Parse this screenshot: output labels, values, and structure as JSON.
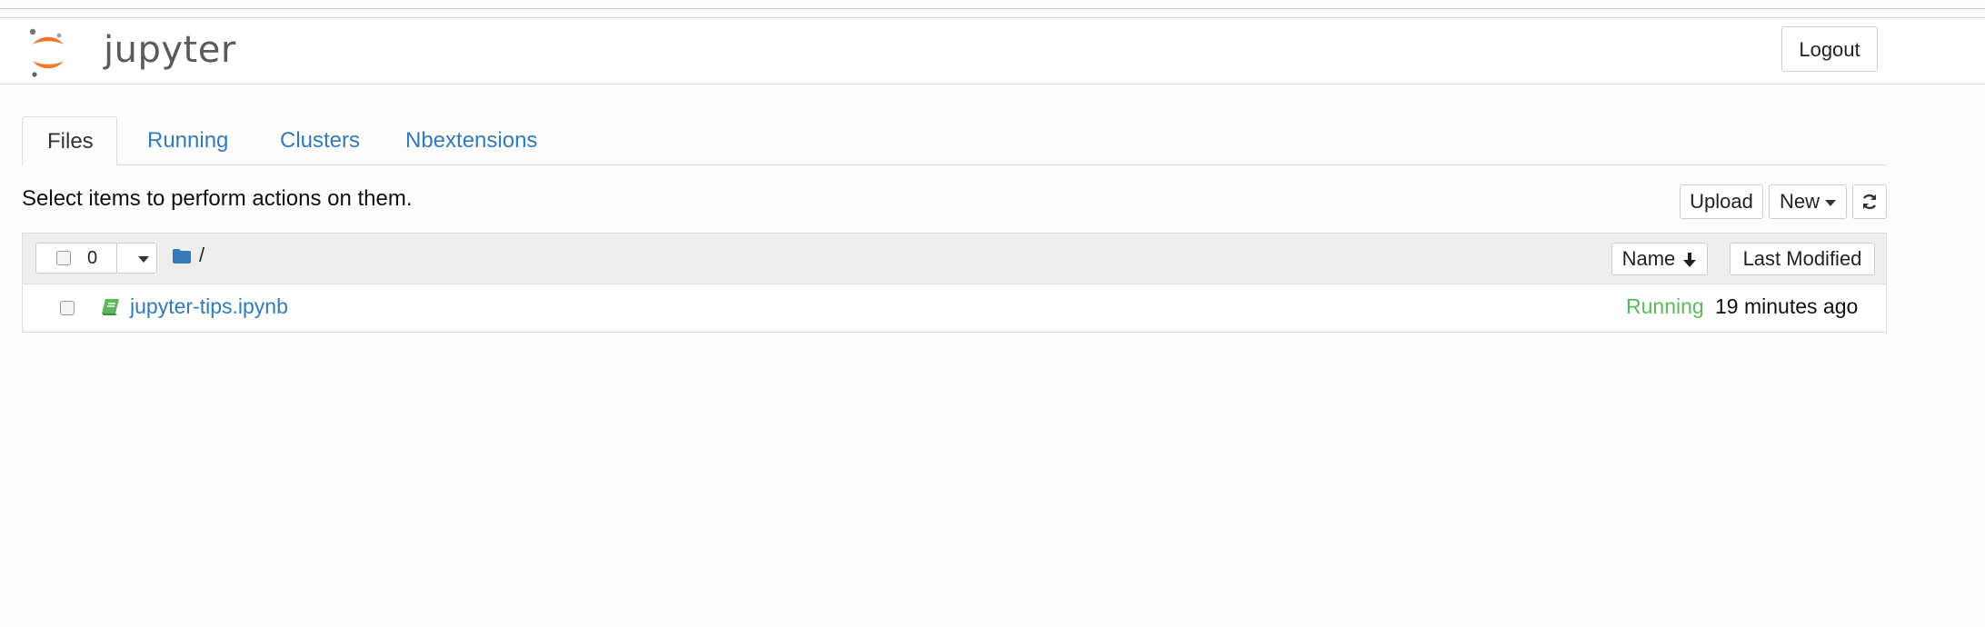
{
  "header": {
    "app_name": "jupyter",
    "logout_label": "Logout"
  },
  "tabs": [
    {
      "label": "Files",
      "active": true
    },
    {
      "label": "Running",
      "active": false
    },
    {
      "label": "Clusters",
      "active": false
    },
    {
      "label": "Nbextensions",
      "active": false
    }
  ],
  "toolbar": {
    "hint_text": "Select items to perform actions on them.",
    "upload_label": "Upload",
    "new_label": "New",
    "refresh_icon": "refresh-icon"
  },
  "list_header": {
    "selected_count": "0",
    "breadcrumb": "/",
    "sort_name_label": "Name",
    "last_modified_label": "Last Modified"
  },
  "files": [
    {
      "name": "jupyter-tips.ipynb",
      "icon": "notebook-icon",
      "status": "Running",
      "modified": "19 minutes ago"
    }
  ],
  "colors": {
    "link": "#337ab7",
    "running": "#5cb85c",
    "logo_orange": "#f37626"
  }
}
